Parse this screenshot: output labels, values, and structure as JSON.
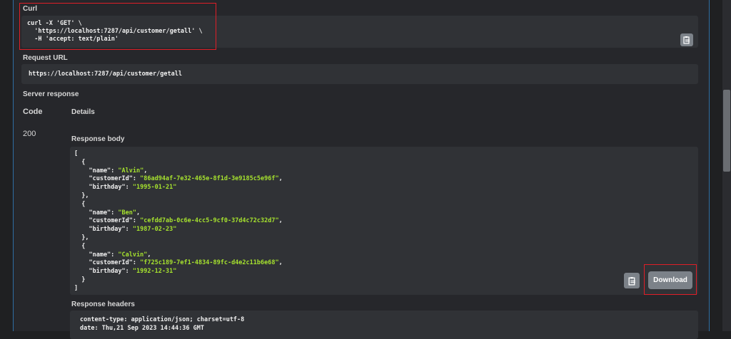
{
  "curl": {
    "label": "Curl",
    "lines": [
      "curl -X 'GET' \\",
      "  'https://localhost:7287/api/customer/getall' \\",
      "  -H 'accept: text/plain'"
    ]
  },
  "request_url": {
    "label": "Request URL",
    "value": "https://localhost:7287/api/customer/getall"
  },
  "server_response": {
    "label": "Server response",
    "code_header": "Code",
    "details_header": "Details",
    "code": "200",
    "response_body_label": "Response body",
    "response_headers_label": "Response headers",
    "download_label": "Download",
    "customers": [
      {
        "name": "Alvin",
        "customerId": "86ad94af-7e32-465e-8f1d-3e9185c5e96f",
        "birthday": "1995-01-21"
      },
      {
        "name": "Ben",
        "customerId": "cefdd7ab-0c6e-4cc5-9cf0-37d4c72c32d7",
        "birthday": "1987-02-23"
      },
      {
        "name": "Calvin",
        "customerId": "f725c189-7ef1-4834-89fc-d4e2c11b6e68",
        "birthday": "1992-12-31"
      }
    ],
    "headers": [
      "content-type: application/json; charset=utf-8",
      "date: Thu,21 Sep 2023 14:44:36 GMT"
    ]
  },
  "icons": {
    "copy": "clipboard-icon"
  }
}
